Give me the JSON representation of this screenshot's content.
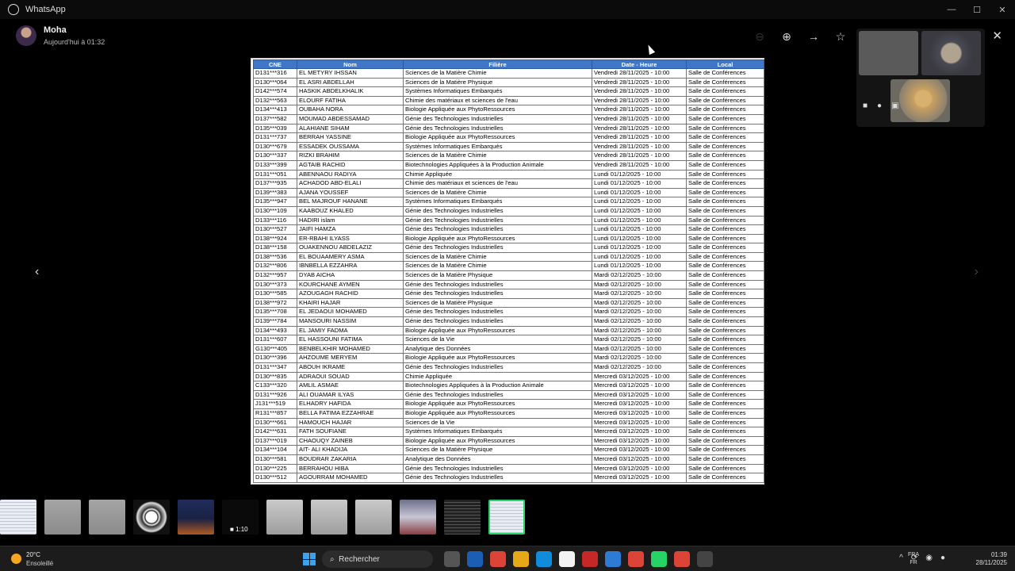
{
  "app": {
    "name": "WhatsApp"
  },
  "header": {
    "sender": "Moha",
    "sent": "Aujourd'hui à 01:32"
  },
  "table": {
    "headers": [
      "CNE",
      "Nom",
      "Filière",
      "Date - Heure",
      "Local"
    ],
    "rows": [
      [
        "D131***316",
        "EL METYRY IHSSAN",
        "Sciences de la Matière Chimie",
        "Vendredi 28/11/2025 - 10:00",
        "Salle de Conférences"
      ],
      [
        "D130***064",
        "EL ASRI ABDELLAH",
        "Sciences de la Matière Physique",
        "Vendredi 28/11/2025 - 10:00",
        "Salle de Conférences"
      ],
      [
        "D142***574",
        "HASKIK ABDELKHALIK",
        "Systèmes Informatiques Embarqués",
        "Vendredi 28/11/2025 - 10:00",
        "Salle de Conférences"
      ],
      [
        "D132***563",
        "ELOURF FATIHA",
        "Chimie des matériaux et sciences de l'eau",
        "Vendredi 28/11/2025 - 10:00",
        "Salle de Conférences"
      ],
      [
        "D134***413",
        "OUBAHA NORA",
        "Biologie Appliquée aux PhytoRessources",
        "Vendredi 28/11/2025 - 10:00",
        "Salle de Conférences"
      ],
      [
        "D137***582",
        "MOUMAD ABDESSAMAD",
        "Génie des Technologies Industrielles",
        "Vendredi 28/11/2025 - 10:00",
        "Salle de Conférences"
      ],
      [
        "D135***039",
        "ALAHIANE SIHAM",
        "Génie des Technologies Industrielles",
        "Vendredi 28/11/2025 - 10:00",
        "Salle de Conférences"
      ],
      [
        "D131***737",
        "BERRAH YASSINE",
        "Biologie Appliquée aux PhytoRessources",
        "Vendredi 28/11/2025 - 10:00",
        "Salle de Conférences"
      ],
      [
        "D130***679",
        "ESSADEK OUSSAMA",
        "Systèmes Informatiques Embarqués",
        "Vendredi 28/11/2025 - 10:00",
        "Salle de Conférences"
      ],
      [
        "D130***337",
        "RIZKI BRAHIM",
        "Sciences de la Matière Chimie",
        "Vendredi 28/11/2025 - 10:00",
        "Salle de Conférences"
      ],
      [
        "D133***399",
        "AGTAIB RACHID",
        "Biotechnologies Appliquées à la Production Animale",
        "Vendredi 28/11/2025 - 10:00",
        "Salle de Conférences"
      ],
      [
        "D131***051",
        "ABENNAOU RADIYA",
        "Chimie Appliquée",
        "Lundi 01/12/2025 - 10:00",
        "Salle de Conférences"
      ],
      [
        "D137***935",
        "ACHADOD ABD-ELALI",
        "Chimie des matériaux et sciences de l'eau",
        "Lundi 01/12/2025 - 10:00",
        "Salle de Conférences"
      ],
      [
        "D139***383",
        "AJANA YOUSSEF",
        "Sciences de la Matière Chimie",
        "Lundi 01/12/2025 - 10:00",
        "Salle de Conférences"
      ],
      [
        "D135***947",
        "BEL MAJROUF HANANE",
        "Systèmes Informatiques Embarqués",
        "Lundi 01/12/2025 - 10:00",
        "Salle de Conférences"
      ],
      [
        "D130***109",
        "KAABOUZ KHALED",
        "Génie des Technologies Industrielles",
        "Lundi 01/12/2025 - 10:00",
        "Salle de Conférences"
      ],
      [
        "D133***116",
        "HADIRI islam",
        "Génie des Technologies Industrielles",
        "Lundi 01/12/2025 - 10:00",
        "Salle de Conférences"
      ],
      [
        "D130***527",
        "JAIFI HAMZA",
        "Génie des Technologies Industrielles",
        "Lundi 01/12/2025 - 10:00",
        "Salle de Conférences"
      ],
      [
        "D138***924",
        "ER-RBAHI ILYASS",
        "Biologie Appliquée aux PhytoRessources",
        "Lundi 01/12/2025 - 10:00",
        "Salle de Conférences"
      ],
      [
        "D138***158",
        "OUAKENNOU ABDELAZIZ",
        "Génie des Technologies Industrielles",
        "Lundi 01/12/2025 - 10:00",
        "Salle de Conférences"
      ],
      [
        "D138***536",
        "EL BOUAAMERY ASMA",
        "Sciences de la Matière Chimie",
        "Lundi 01/12/2025 - 10:00",
        "Salle de Conférences"
      ],
      [
        "D132***806",
        "IBNBELLA EZZAHRA",
        "Sciences de la Matière Chimie",
        "Lundi 01/12/2025 - 10:00",
        "Salle de Conférences"
      ],
      [
        "D132***957",
        "DYAB AICHA",
        "Sciences de la Matière Physique",
        "Mardi 02/12/2025 - 10:00",
        "Salle de Conférences"
      ],
      [
        "D130***373",
        "KOURCHANE AYMEN",
        "Génie des Technologies Industrielles",
        "Mardi 02/12/2025 - 10:00",
        "Salle de Conférences"
      ],
      [
        "D130***585",
        "AZOUGAGH RACHID",
        "Génie des Technologies Industrielles",
        "Mardi 02/12/2025 - 10:00",
        "Salle de Conférences"
      ],
      [
        "D138***972",
        "KHAIRI HAJAR",
        "Sciences de la Matière Physique",
        "Mardi 02/12/2025 - 10:00",
        "Salle de Conférences"
      ],
      [
        "D135***708",
        "EL JEDAOUI MOHAMED",
        "Génie des Technologies Industrielles",
        "Mardi 02/12/2025 - 10:00",
        "Salle de Conférences"
      ],
      [
        "D139***784",
        "MANSOURI NASSIM",
        "Génie des Technologies Industrielles",
        "Mardi 02/12/2025 - 10:00",
        "Salle de Conférences"
      ],
      [
        "D134***493",
        "EL JAMIY FADMA",
        "Biologie Appliquée aux PhytoRessources",
        "Mardi 02/12/2025 - 10:00",
        "Salle de Conférences"
      ],
      [
        "D131***607",
        "EL HASSOUNI FATIMA",
        "Sciences de la Vie",
        "Mardi 02/12/2025 - 10:00",
        "Salle de Conférences"
      ],
      [
        "G130***405",
        "BENBELKHIR MOHAMED",
        "Analytique des Données",
        "Mardi 02/12/2025 - 10:00",
        "Salle de Conférences"
      ],
      [
        "D130***396",
        "AHZOUME MERYEM",
        "Biologie Appliquée aux PhytoRessources",
        "Mardi 02/12/2025 - 10:00",
        "Salle de Conférences"
      ],
      [
        "D131***347",
        "ABOUH IKRAME",
        "Génie des Technologies Industrielles",
        "Mardi 02/12/2025 - 10:00",
        "Salle de Conférences"
      ],
      [
        "D130***835",
        "ADRAOUI SOUAD",
        "Chimie Appliquée",
        "Mercredi 03/12/2025 - 10:00",
        "Salle de Conférences"
      ],
      [
        "C133***320",
        "AMLIL ASMAE",
        "Biotechnologies Appliquées à la Production Animale",
        "Mercredi 03/12/2025 - 10:00",
        "Salle de Conférences"
      ],
      [
        "D131***926",
        "ALI OUAMAR ILYAS",
        "Génie des Technologies Industrielles",
        "Mercredi 03/12/2025 - 10:00",
        "Salle de Conférences"
      ],
      [
        "J131***519",
        "ELHADRY HAFIDA",
        "Biologie Appliquée aux PhytoRessources",
        "Mercredi 03/12/2025 - 10:00",
        "Salle de Conférences"
      ],
      [
        "R131***857",
        "BELLA FATIMA EZZAHRAE",
        "Biologie Appliquée aux PhytoRessources",
        "Mercredi 03/12/2025 - 10:00",
        "Salle de Conférences"
      ],
      [
        "D130***661",
        "HAMOUCH HAJAR",
        "Sciences de la Vie",
        "Mercredi 03/12/2025 - 10:00",
        "Salle de Conférences"
      ],
      [
        "D142***631",
        "FATH SOUFIANE",
        "Systèmes Informatiques Embarqués",
        "Mercredi 03/12/2025 - 10:00",
        "Salle de Conférences"
      ],
      [
        "D137***019",
        "CHAOUQY ZAINEB",
        "Biologie Appliquée aux PhytoRessources",
        "Mercredi 03/12/2025 - 10:00",
        "Salle de Conférences"
      ],
      [
        "D134***104",
        "AIT- ALI KHADIJA",
        "Sciences de la Matière Physique",
        "Mercredi 03/12/2025 - 10:00",
        "Salle de Conférences"
      ],
      [
        "D130***581",
        "BOUDRAR ZAKARIA",
        "Analytique des Données",
        "Mercredi 03/12/2025 - 10:00",
        "Salle de Conférences"
      ],
      [
        "D130***225",
        "BERRAHOU HIBA",
        "Génie des Technologies Industrielles",
        "Mercredi 03/12/2025 - 10:00",
        "Salle de Conférences"
      ],
      [
        "D130***512",
        "AGOURRAM MOHAMED",
        "Génie des Technologies Industrielles",
        "Mercredi 03/12/2025 - 10:00",
        "Salle de Conférences"
      ]
    ]
  },
  "thumbnails": [
    {
      "kind": "t-doc"
    },
    {
      "kind": "t-wall"
    },
    {
      "kind": "t-wall"
    },
    {
      "kind": "t-clock"
    },
    {
      "kind": "t-poster"
    },
    {
      "kind": "t-black",
      "duration": "1:10"
    },
    {
      "kind": "t-board"
    },
    {
      "kind": "t-board"
    },
    {
      "kind": "t-board"
    },
    {
      "kind": "t-photo"
    },
    {
      "kind": "t-dark"
    },
    {
      "kind": "t-doc",
      "selected": true
    }
  ],
  "taskbar": {
    "weather_temp": "20°C",
    "weather_cond": "Ensoleillé",
    "search_placeholder": "Rechercher",
    "lang_top": "FRA",
    "lang_bottom": "FR",
    "time": "01:39",
    "date": "28/11/2025"
  },
  "colors": {
    "accent": "#25d366",
    "table_header": "#3f76c8"
  }
}
